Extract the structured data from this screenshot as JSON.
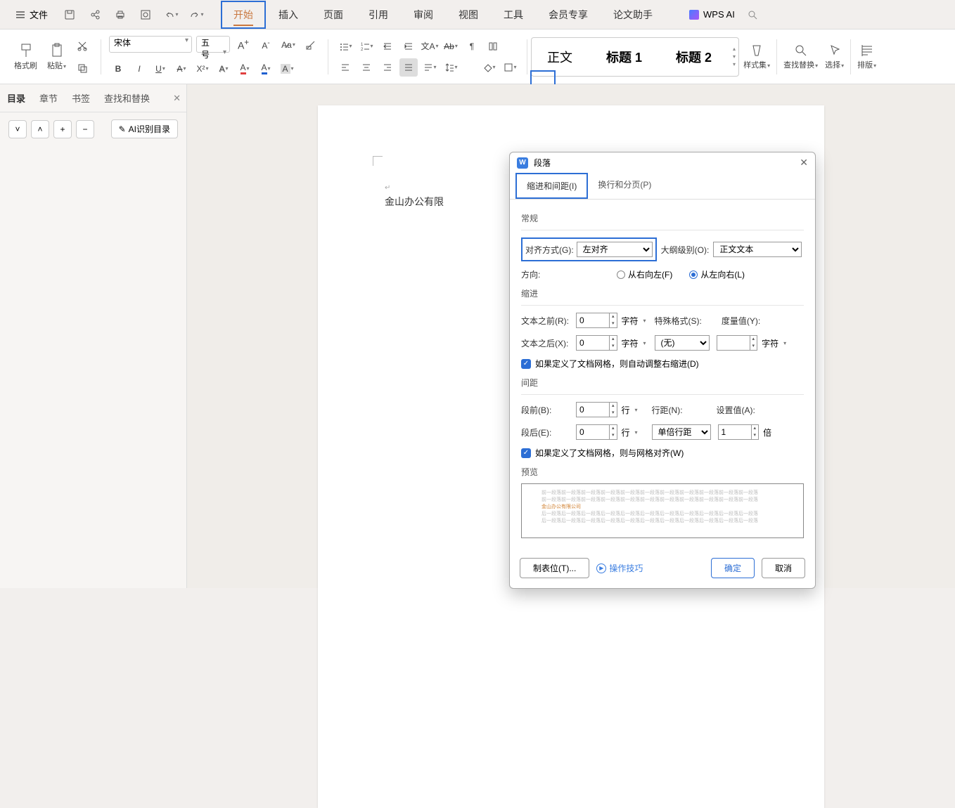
{
  "top": {
    "file": "文件",
    "tabs": [
      "开始",
      "插入",
      "页面",
      "引用",
      "审阅",
      "视图",
      "工具",
      "会员专享",
      "论文助手"
    ],
    "active_tab": 0,
    "wps_ai": "WPS AI"
  },
  "ribbon": {
    "format_painter": "格式刷",
    "paste": "粘贴",
    "font_name": "宋体",
    "font_size": "五号",
    "styles": {
      "body": "正文",
      "h1": "标题 1",
      "h2": "标题 2"
    },
    "style_set": "样式集",
    "find_replace": "查找替换",
    "select": "选择",
    "layout": "排版"
  },
  "panel": {
    "tabs": [
      "目录",
      "章节",
      "书签",
      "查找和替换"
    ],
    "active": 0,
    "ai_toc": "AI识别目录"
  },
  "document": {
    "text": "金山办公有限"
  },
  "dialog": {
    "title": "段落",
    "tabs": [
      "缩进和间距(I)",
      "换行和分页(P)"
    ],
    "active_tab": 0,
    "section_general": "常规",
    "alignment_label": "对齐方式(G):",
    "alignment_value": "左对齐",
    "outline_label": "大纲级别(O):",
    "outline_value": "正文文本",
    "direction_label": "方向:",
    "rtl": "从右向左(F)",
    "ltr": "从左向右(L)",
    "section_indent": "缩进",
    "before_text": "文本之前(R):",
    "after_text": "文本之后(X):",
    "unit_char": "字符",
    "special_label": "特殊格式(S):",
    "special_value": "(无)",
    "measure_label": "度量值(Y):",
    "auto_indent": "如果定义了文档网格，则自动调整右缩进(D)",
    "section_spacing": "间距",
    "before_para": "段前(B):",
    "after_para": "段后(E):",
    "unit_line": "行",
    "line_spacing_label": "行距(N):",
    "line_spacing_value": "单倍行距",
    "set_value_label": "设置值(A):",
    "set_value": "1",
    "unit_bei": "倍",
    "snap_grid": "如果定义了文档网格，则与网格对齐(W)",
    "section_preview": "预览",
    "preview_sample": "金山办公有限公司",
    "tabs_btn": "制表位(T)...",
    "tips": "操作技巧",
    "ok": "确定",
    "cancel": "取消",
    "val_zero": "0"
  }
}
